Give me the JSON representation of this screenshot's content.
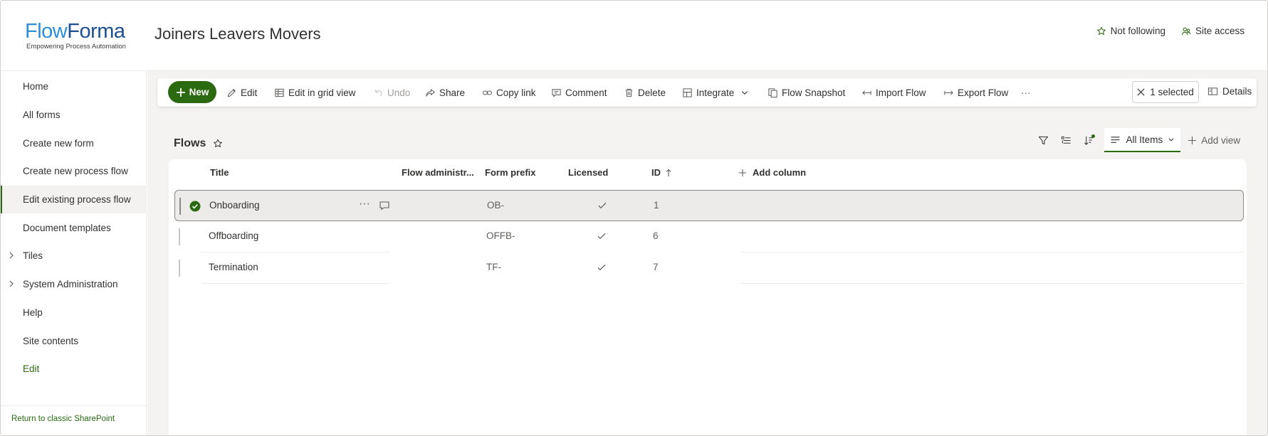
{
  "header": {
    "logo_flow": "Flow",
    "logo_forma": "Forma",
    "logo_tagline": "Empowering Process Automation",
    "site_title": "Joiners Leavers Movers",
    "follow_label": "Not following",
    "site_access_label": "Site access"
  },
  "sidebar": {
    "items": [
      {
        "label": "Home"
      },
      {
        "label": "All forms"
      },
      {
        "label": "Create new form"
      },
      {
        "label": "Create new process flow"
      },
      {
        "label": "Edit existing process flow"
      },
      {
        "label": "Document templates"
      },
      {
        "label": "Tiles"
      },
      {
        "label": "System Administration"
      },
      {
        "label": "Help"
      },
      {
        "label": "Site contents"
      },
      {
        "label": "Edit"
      }
    ],
    "classic_link": "Return to classic SharePoint"
  },
  "commandbar": {
    "new": "New",
    "edit": "Edit",
    "edit_grid": "Edit in grid view",
    "undo": "Undo",
    "share": "Share",
    "copy_link": "Copy link",
    "comment": "Comment",
    "delete": "Delete",
    "integrate": "Integrate",
    "flow_snapshot": "Flow Snapshot",
    "import_flow": "Import Flow",
    "export_flow": "Export Flow",
    "more": "···",
    "selected": "1 selected",
    "details": "Details"
  },
  "view": {
    "title": "Flows",
    "current_view": "All Items",
    "add_view": "Add view"
  },
  "list": {
    "columns": {
      "title": "Title",
      "flow_admin": "Flow administr...",
      "form_prefix": "Form prefix",
      "licensed": "Licensed",
      "id": "ID",
      "add_column": "Add column"
    },
    "rows": [
      {
        "title": "Onboarding",
        "form_prefix": "OB-",
        "licensed": true,
        "id": "1"
      },
      {
        "title": "Offboarding",
        "form_prefix": "OFFB-",
        "licensed": true,
        "id": "6"
      },
      {
        "title": "Termination",
        "form_prefix": "TF-",
        "licensed": true,
        "id": "7"
      }
    ],
    "row_more": "···"
  },
  "colors": {
    "accent": "#2c6a12",
    "logo_light": "#2d8fd5",
    "logo_dark": "#1d4f91"
  }
}
